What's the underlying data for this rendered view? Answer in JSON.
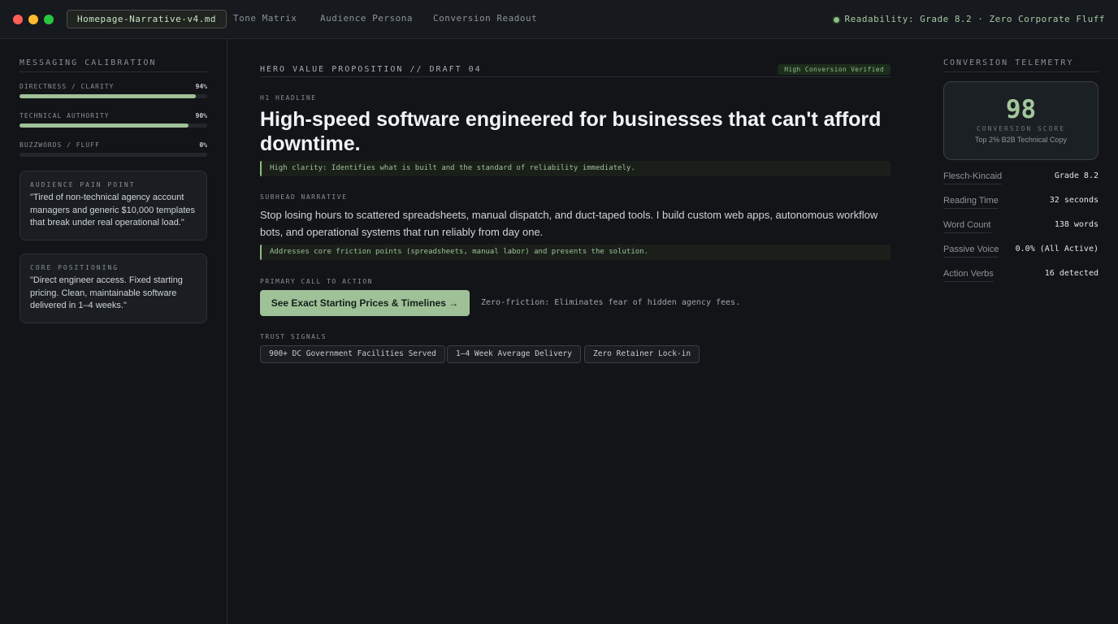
{
  "window": {
    "tabs": [
      "Homepage-Narrative-v4.md",
      "Tone Matrix",
      "Audience Persona",
      "Conversion Readout"
    ],
    "status": "Readability: Grade 8.2 · Zero Corporate Fluff"
  },
  "calibration": {
    "title": "MESSAGING CALIBRATION",
    "metrics": [
      {
        "label": "DIRECTNESS / CLARITY",
        "value": "94%",
        "level": 0.94
      },
      {
        "label": "TECHNICAL AUTHORITY",
        "value": "90%",
        "level": 0.9
      },
      {
        "label": "BUZZWORDS / FLUFF",
        "value": "0%",
        "level": 0.0
      }
    ],
    "cards": [
      {
        "title": "AUDIENCE PAIN POINT",
        "text": "\"Tired of non-technical agency account managers and generic $10,000 templates that break under real operational load.\""
      },
      {
        "title": "CORE POSITIONING",
        "text": "\"Direct engineer access. Fixed starting pricing. Clean, maintainable software delivered in 1–4 weeks.\""
      }
    ]
  },
  "hero": {
    "title": "HERO VALUE PROPOSITION // DRAFT 04",
    "badge": "High Conversion Verified",
    "h1_label": "H1 HEADLINE",
    "h1": "High-speed software engineered for businesses that can't afford downtime.",
    "h1_note": "High clarity: Identifies what is built and the standard of reliability immediately.",
    "sub_label": "SUBHEAD NARRATIVE",
    "sub": "Stop losing hours to scattered spreadsheets, manual dispatch, and duct-taped tools. I build custom web apps, autonomous workflow bots, and operational systems that run reliably from day one.",
    "sub_note": "Addresses core friction points (spreadsheets, manual labor) and presents the solution.",
    "cta_label": "PRIMARY CALL TO ACTION",
    "cta": "See Exact Starting Prices & Timelines →",
    "cta_note": "Zero-friction: Eliminates fear of hidden agency fees.",
    "trust_label": "TRUST SIGNALS",
    "trust": [
      "900+ DC Government Facilities Served",
      "1–4 Week Average Delivery",
      "Zero Retainer Lock-in"
    ]
  },
  "telemetry": {
    "title": "CONVERSION TELEMETRY",
    "score": "98",
    "score_label": "CONVERSION SCORE",
    "score_desc": "Top 2% B2B Technical Copy",
    "stats": [
      {
        "label": "Flesch-Kincaid",
        "value": "Grade 8.2"
      },
      {
        "label": "Reading Time",
        "value": "32 seconds"
      },
      {
        "label": "Word Count",
        "value": "138 words"
      },
      {
        "label": "Passive Voice",
        "value": "0.0% (All Active)"
      },
      {
        "label": "Action Verbs",
        "value": "16 detected"
      }
    ]
  },
  "colors": {
    "accent": "#9fc198",
    "background": "#121417"
  }
}
